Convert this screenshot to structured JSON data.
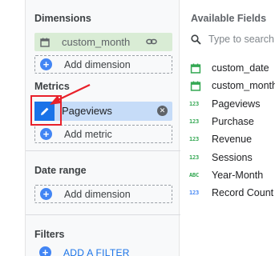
{
  "dimensions": {
    "title": "Dimensions",
    "chip_label": "custom_month",
    "add_label": "Add dimension"
  },
  "metrics": {
    "title": "Metrics",
    "chip_label": "Pageviews",
    "add_label": "Add metric"
  },
  "date_range": {
    "title": "Date range",
    "add_label": "Add dimension"
  },
  "filters": {
    "title": "Filters",
    "add_label": "ADD A FILTER"
  },
  "available_fields": {
    "title": "Available Fields",
    "search_placeholder": "Type to search",
    "items": [
      {
        "label": "custom_date",
        "icon": "calendar-icon",
        "icon_text": ""
      },
      {
        "label": "custom_month",
        "icon": "calendar-icon",
        "icon_text": ""
      },
      {
        "label": "Pageviews",
        "icon": "number-icon",
        "icon_text": "123"
      },
      {
        "label": "Purchase",
        "icon": "number-icon",
        "icon_text": "123"
      },
      {
        "label": "Revenue",
        "icon": "number-icon",
        "icon_text": "123"
      },
      {
        "label": "Sessions",
        "icon": "number-icon",
        "icon_text": "123"
      },
      {
        "label": "Year-Month",
        "icon": "text-icon",
        "icon_text": "ABC"
      },
      {
        "label": "Record Count",
        "icon": "number-icon-blue",
        "icon_text": "123"
      }
    ]
  },
  "colors": {
    "dimension_chip": "#d9ecd5",
    "metric_chip": "#c6dcf8",
    "accent": "#1a73e8",
    "field_green": "#34a853",
    "highlight_red": "#e8202a"
  }
}
